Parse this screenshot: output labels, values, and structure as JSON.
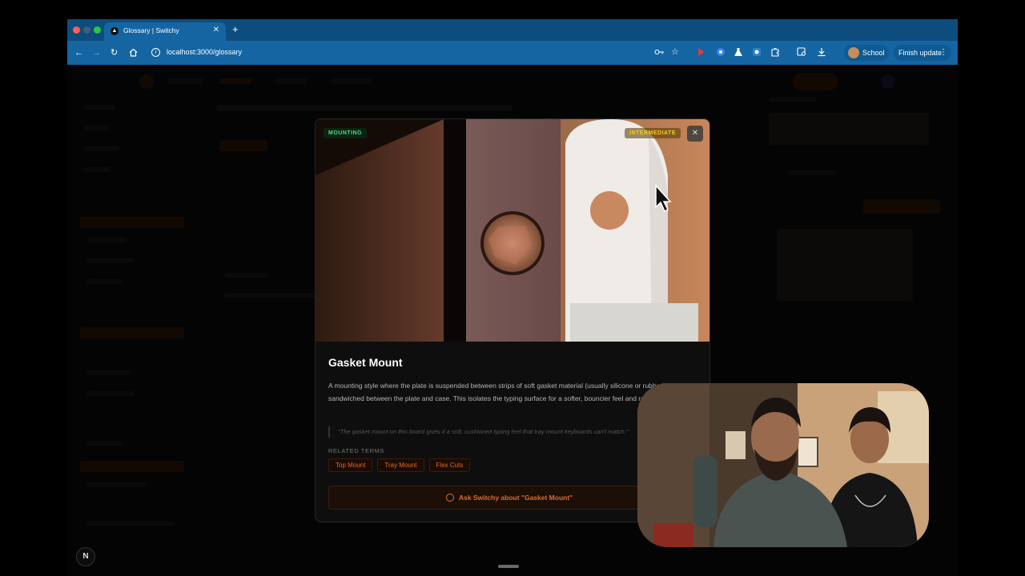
{
  "browser": {
    "tab_title": "Glossary | Switchy",
    "url": "localhost:3000/glossary",
    "profile_label": "School",
    "finish_update_label": "Finish update"
  },
  "modal": {
    "category": "MOUNTING",
    "level": "INTERMEDIATE",
    "title": "Gasket Mount",
    "definition": "A mounting style where the plate is suspended between strips of soft gasket material (usually silicone or rubber) sandwiched between the plate and case. This isolates the typing surface for a softer, bouncier feel and reduced case ping.",
    "quote": "\"The gasket mount on this board gives it a soft, cushioned typing feel that tray mount keyboards can't match.\"",
    "related_heading": "RELATED TERMS",
    "related_terms": [
      "Top Mount",
      "Tray Mount",
      "Flex Cuts"
    ],
    "ask_label": "Ask Switchy about \"Gasket Mount\""
  },
  "colors": {
    "accent": "#e06b2e",
    "tab_bar": "#0d4d7e",
    "toolbar": "#1565a3",
    "category_badge": "#4ade80",
    "level_badge": "#facc15"
  },
  "icons": {
    "back": "arrow-left-icon",
    "forward": "arrow-right-icon",
    "reload": "reload-icon",
    "home": "home-icon",
    "bookmark": "star-icon",
    "extensions": "puzzle-icon",
    "downloads": "download-icon",
    "close": "close-icon",
    "ask": "chat-icon",
    "nextjs": "nextjs-icon"
  },
  "next_badge": "N"
}
